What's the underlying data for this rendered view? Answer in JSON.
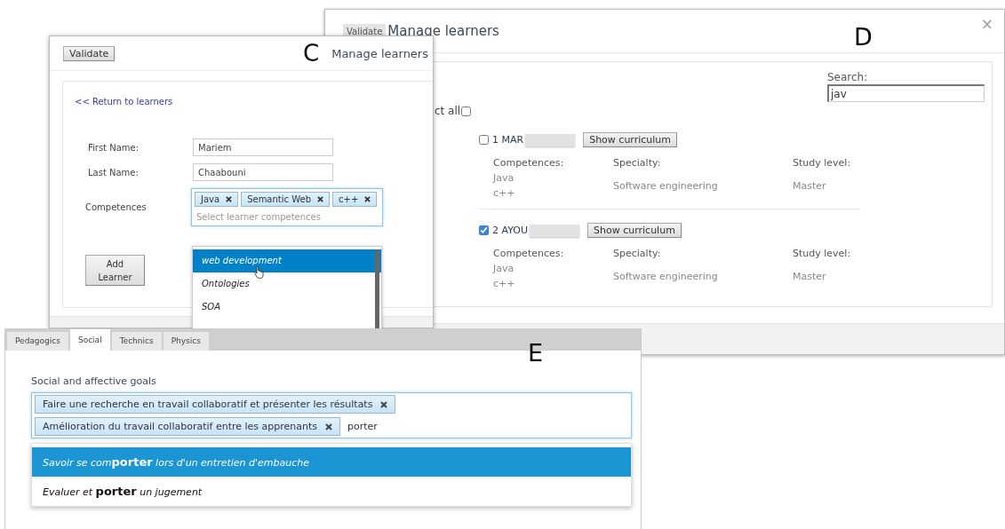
{
  "panel_d": {
    "label": "D",
    "validate_button": "Validate",
    "title": "Manage learners",
    "close": "×",
    "search": {
      "label": "Search:",
      "value": "jav"
    },
    "select_all": {
      "label": "ct all",
      "checked": false
    },
    "learners": [
      {
        "name": "1 MAR",
        "checked": false,
        "button": "Show curriculum",
        "fields": [
          {
            "label": "Competences:",
            "values": [
              "Java",
              "c++"
            ]
          },
          {
            "label": "Specialty:",
            "values": [
              "Software engineering"
            ]
          },
          {
            "label": "Study level:",
            "values": [
              "Master"
            ]
          }
        ]
      },
      {
        "name": "2 AYOU",
        "checked": true,
        "button": "Show curriculum",
        "fields": [
          {
            "label": "Competences:",
            "values": [
              "Java",
              "c++"
            ]
          },
          {
            "label": "Specialty:",
            "values": [
              "Software engineering"
            ]
          },
          {
            "label": "Study level:",
            "values": [
              "Master"
            ]
          }
        ]
      }
    ]
  },
  "panel_c": {
    "label": "C",
    "validate_button": "Validate",
    "title": "Manage learners",
    "return_link": "<< Return to learners",
    "fields": [
      {
        "label": "First Name:",
        "value": "Mariem"
      },
      {
        "label": "Last Name:",
        "value": "Chaabouni"
      }
    ],
    "competences": {
      "label": "Competences",
      "tags": [
        "Java",
        "Semantic Web",
        "c++"
      ],
      "placeholder": "Select learner competences",
      "options": [
        {
          "text": "web development",
          "selected": true
        },
        {
          "text": "Ontologies",
          "selected": false
        },
        {
          "text": "SOA",
          "selected": false
        }
      ]
    },
    "add_button": "Add Learner"
  },
  "panel_e": {
    "label": "E",
    "tabs": [
      {
        "label": "Pedagogics",
        "selected": false
      },
      {
        "label": "Social",
        "selected": true
      },
      {
        "label": "Technics",
        "selected": false
      },
      {
        "label": "Physics",
        "selected": false
      }
    ],
    "goals": {
      "label": "Social and affective goals",
      "tags": [
        "Faire une recherche en travail collaboratif et présenter les résultats",
        "Amélioration du travail collaboratif entre les apprenants"
      ],
      "value": "porter",
      "options": [
        {
          "text": "Savoir se com**porter** lors d'un entretien d'embauche",
          "selected": true
        },
        {
          "text": "Evaluer et **porter** un jugement",
          "selected": false
        }
      ]
    }
  }
}
